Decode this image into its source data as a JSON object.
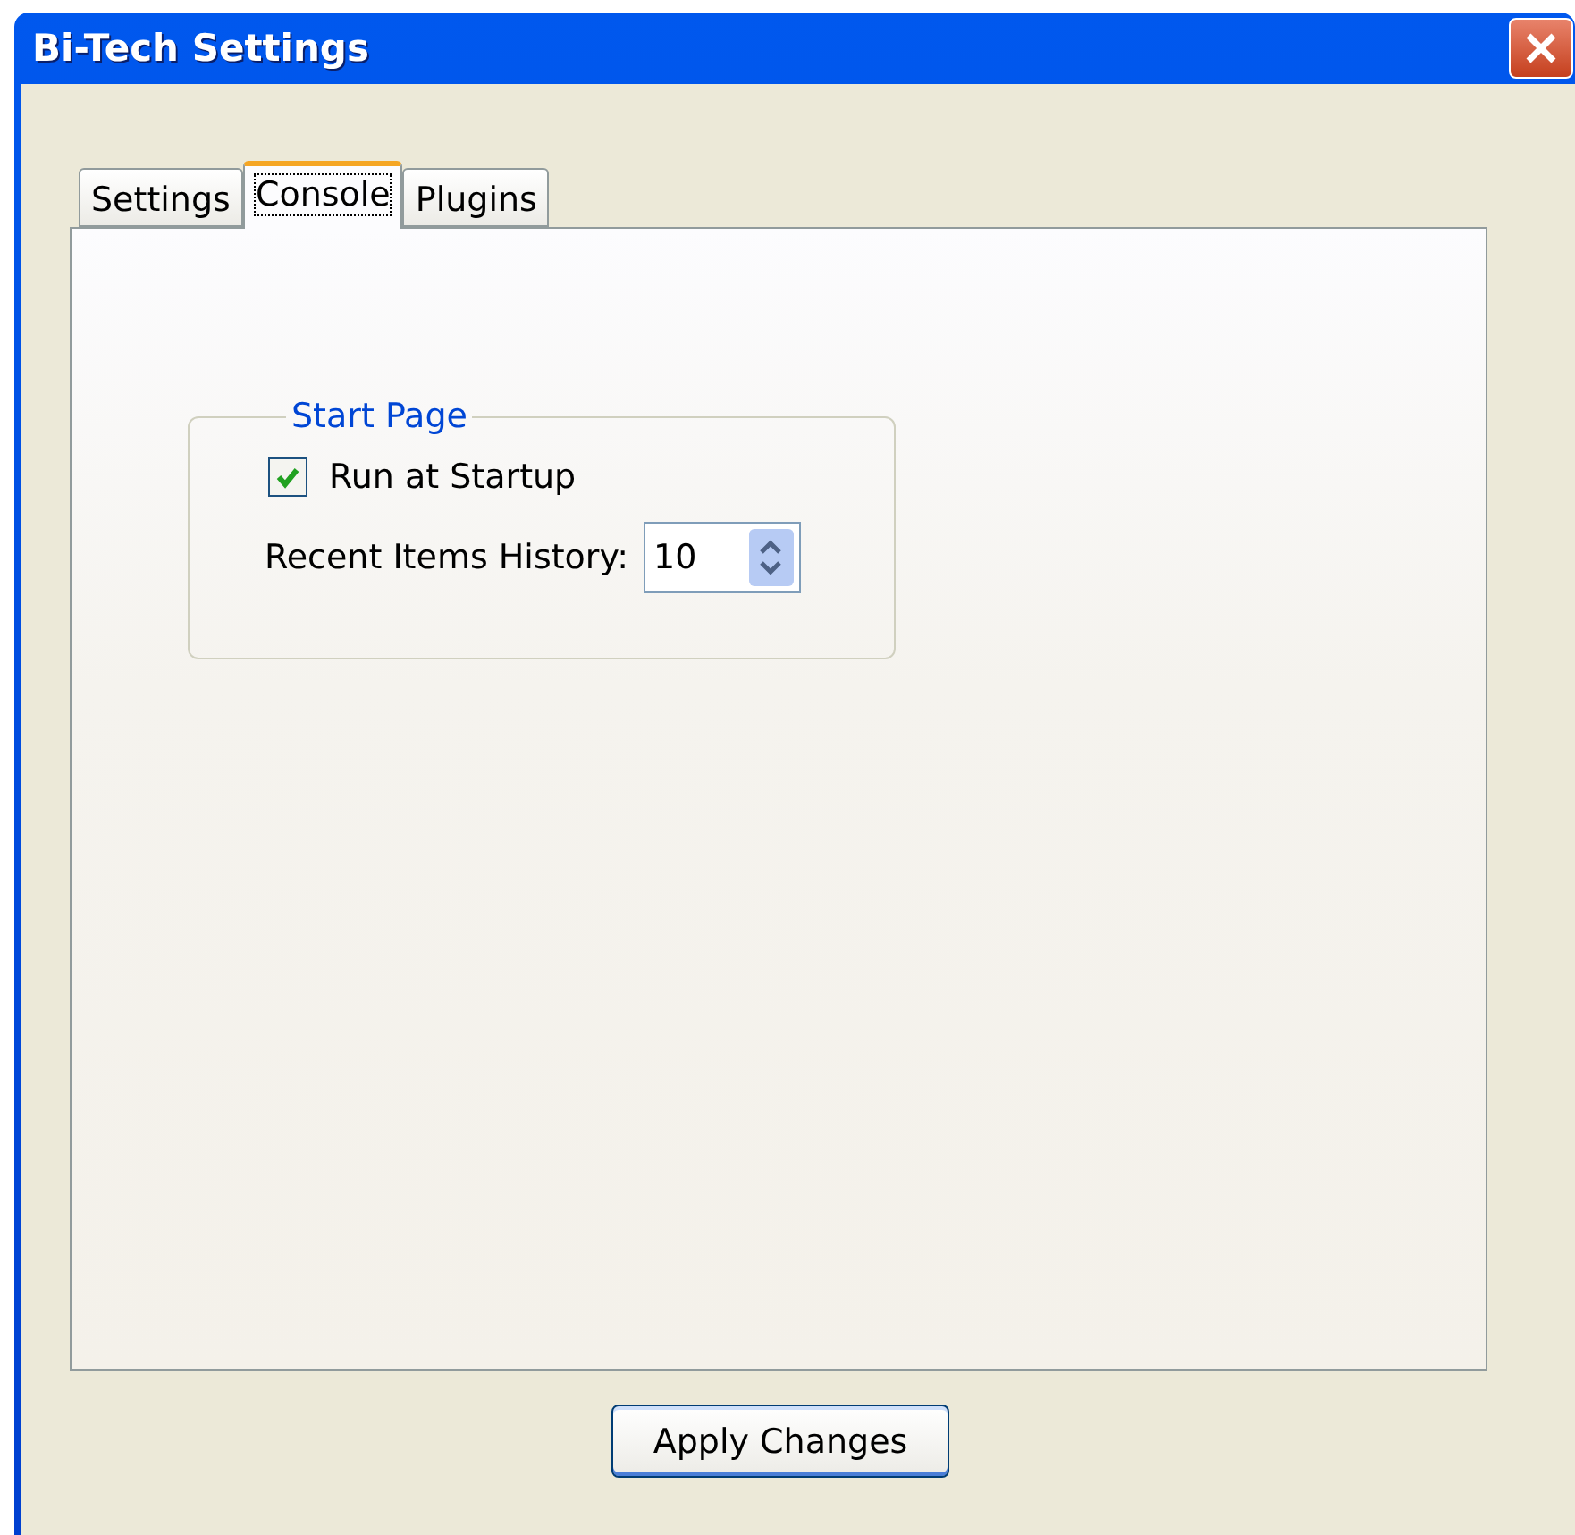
{
  "window": {
    "title": "Bi-Tech Settings"
  },
  "tabs": [
    {
      "label": "Settings",
      "selected": false
    },
    {
      "label": "Console",
      "selected": true
    },
    {
      "label": "Plugins",
      "selected": false
    }
  ],
  "group": {
    "title": "Start Page",
    "run_at_startup": {
      "label": "Run at Startup",
      "checked": true
    },
    "recent_items": {
      "label": "Recent Items History:",
      "value": "10"
    }
  },
  "buttons": [
    "Apply Changes"
  ]
}
